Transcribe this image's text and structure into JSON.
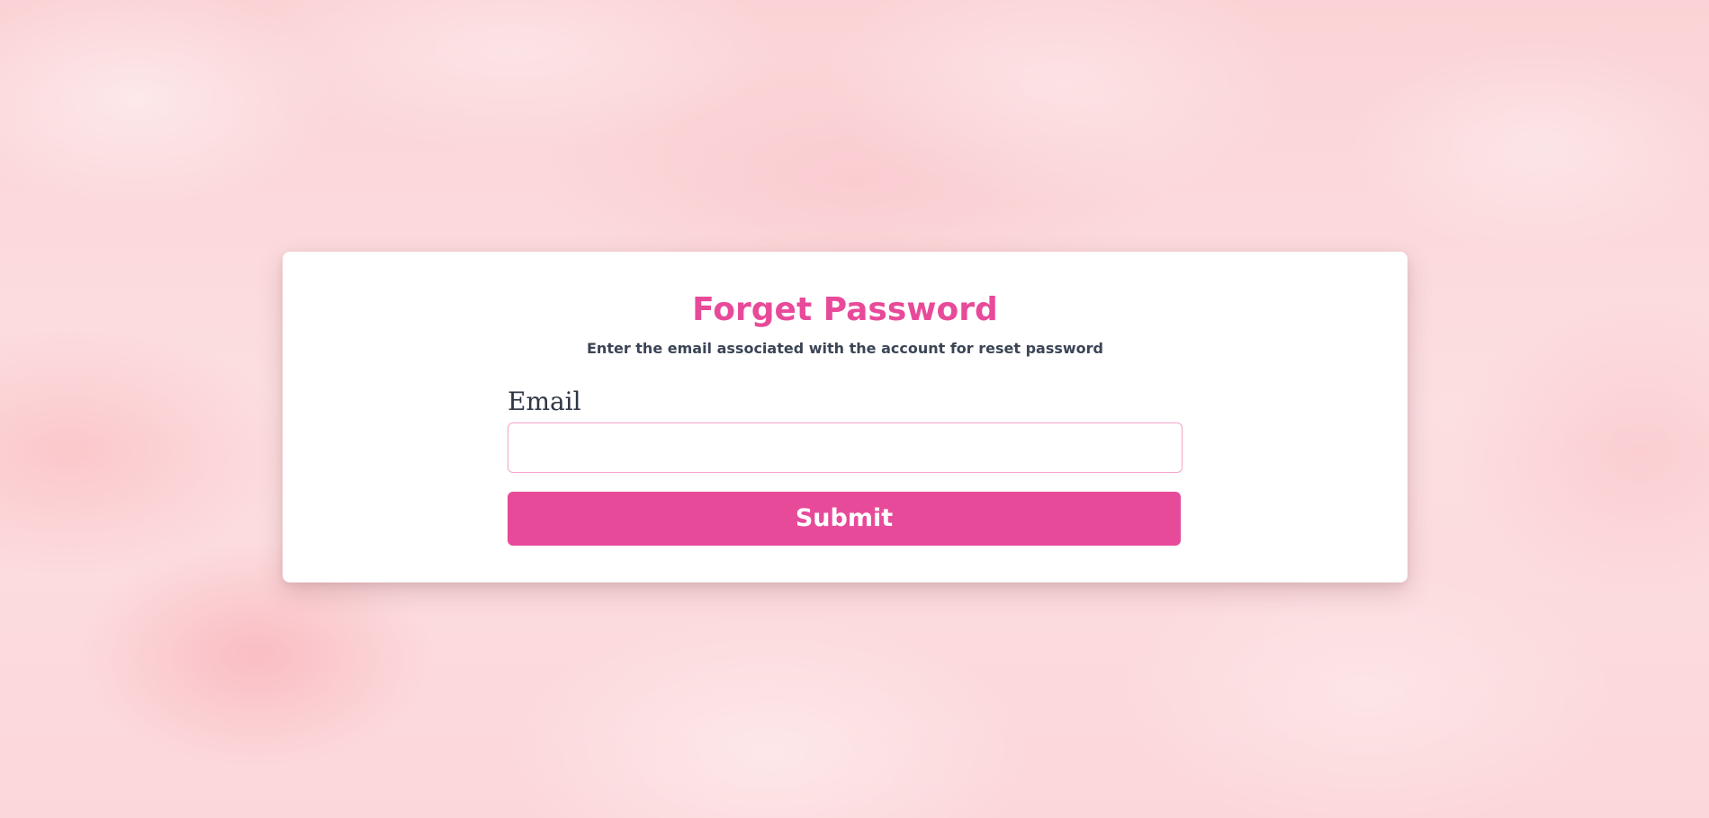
{
  "form": {
    "title": "Forget Password",
    "subtitle": "Enter the email associated with the account for reset password",
    "email_label": "Email",
    "email_value": "",
    "email_placeholder": "",
    "submit_label": "Submit"
  },
  "colors": {
    "accent": "#e84a9a",
    "text": "#3b4556",
    "input_border": "#f4a3c8",
    "background": "#fcd9dc",
    "card": "#ffffff"
  }
}
